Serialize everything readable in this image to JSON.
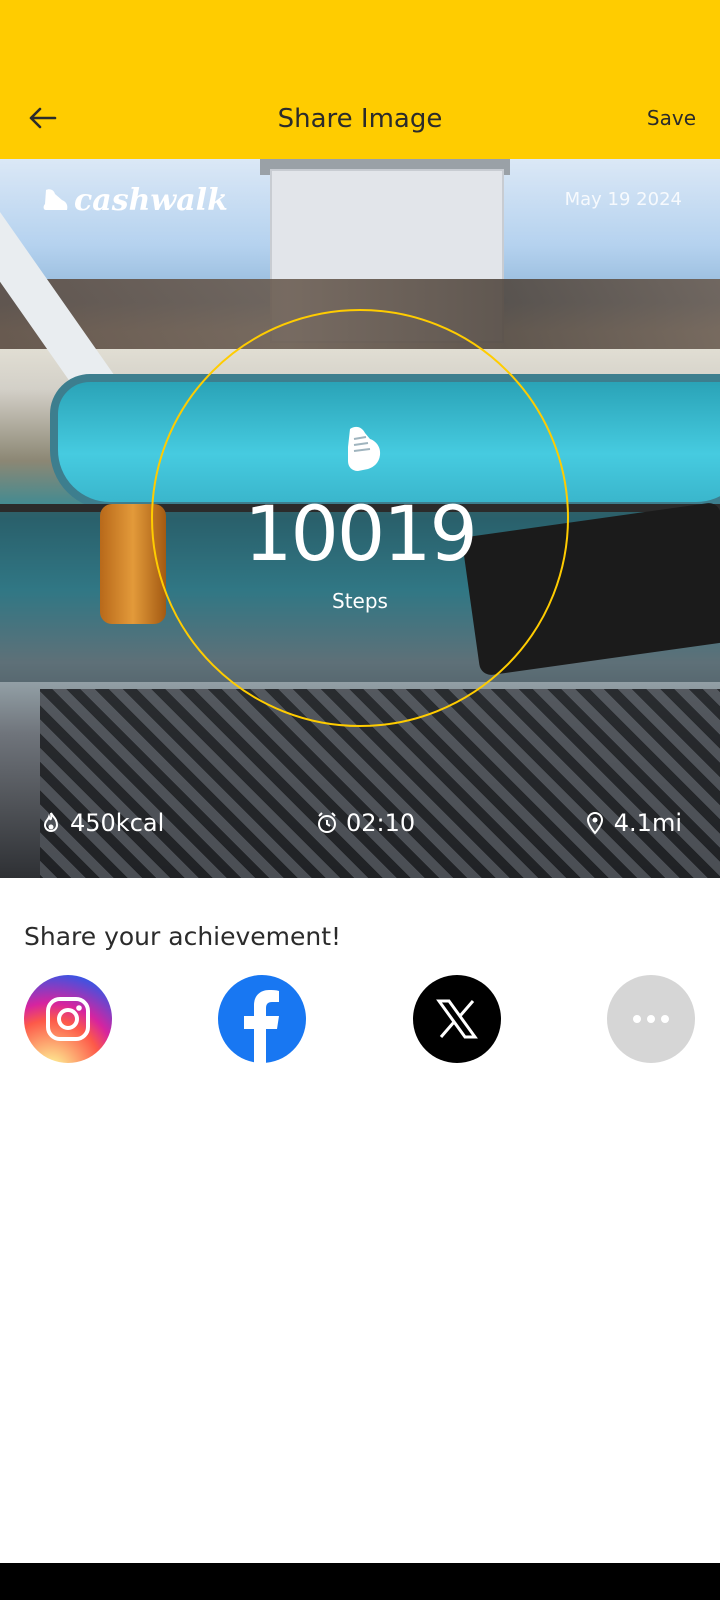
{
  "header": {
    "title": "Share Image",
    "save_label": "Save",
    "back_icon": "arrow-left-icon"
  },
  "card": {
    "brand": "cashwalk",
    "date": "May 19 2024",
    "steps_value": "10019",
    "steps_label": "Steps",
    "ring_color": "#FFCC00",
    "stats": {
      "calories": "450kcal",
      "time": "02:10",
      "distance": "4.1mi"
    }
  },
  "share": {
    "title": "Share your achievement!",
    "buttons": [
      "instagram-icon",
      "facebook-icon",
      "x-icon",
      "more-icon"
    ]
  },
  "colors": {
    "accent": "#FFCC00",
    "facebook": "#1877F2",
    "x": "#000000",
    "more": "#D6D6D6"
  }
}
